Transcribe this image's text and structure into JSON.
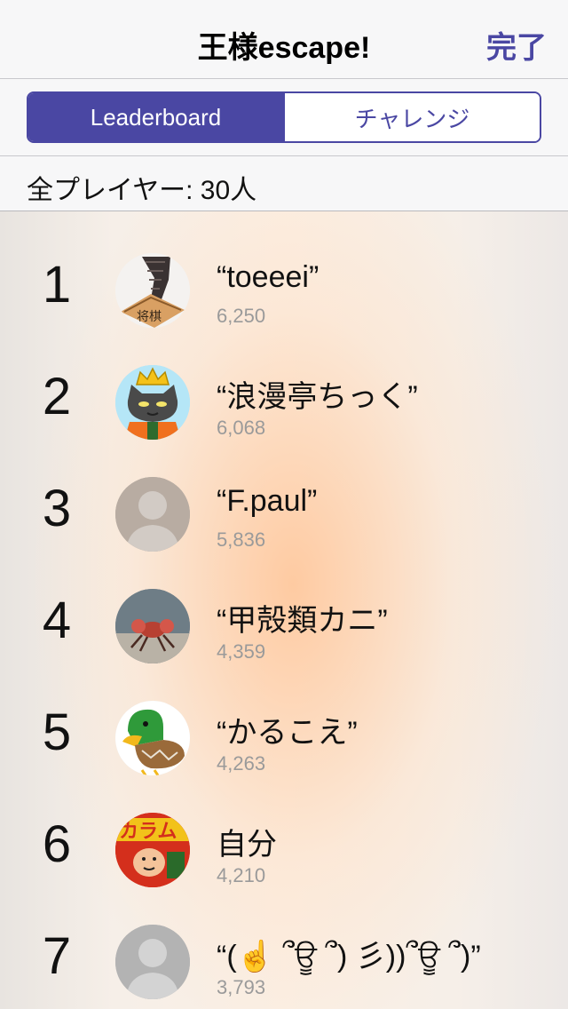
{
  "nav": {
    "title": "王様escape!",
    "done_label": "完了"
  },
  "segments": [
    {
      "label": "Leaderboard",
      "selected": true
    },
    {
      "label": "チャレンジ",
      "selected": false
    }
  ],
  "player_count_text": "全プレイヤー: 30人",
  "colors": {
    "accent": "#4a47a3",
    "score_gray": "#9a9a9a"
  },
  "leaderboard": [
    {
      "rank": "1",
      "name": "“toeeei”",
      "score": "6,250",
      "avatar": "shoe-photo-avatar"
    },
    {
      "rank": "2",
      "name": "“浪漫亭ちっく”",
      "score": "6,068",
      "avatar": "crowned-cat-avatar"
    },
    {
      "rank": "3",
      "name": "“F.paul”",
      "score": "5,836",
      "avatar": "default-person-avatar"
    },
    {
      "rank": "4",
      "name": "“甲殻類カニ”",
      "score": "4,359",
      "avatar": "crab-photo-avatar"
    },
    {
      "rank": "5",
      "name": "“かるこえ”",
      "score": "4,263",
      "avatar": "duck-avatar"
    },
    {
      "rank": "6",
      "name": "自分",
      "score": "4,210",
      "avatar": "snack-package-avatar"
    },
    {
      "rank": "7",
      "name": "“(☝️ ՞ਊ ՞) 彡))՞ਊ ՞)”",
      "score": "3,793",
      "avatar": "default-person-avatar"
    }
  ]
}
